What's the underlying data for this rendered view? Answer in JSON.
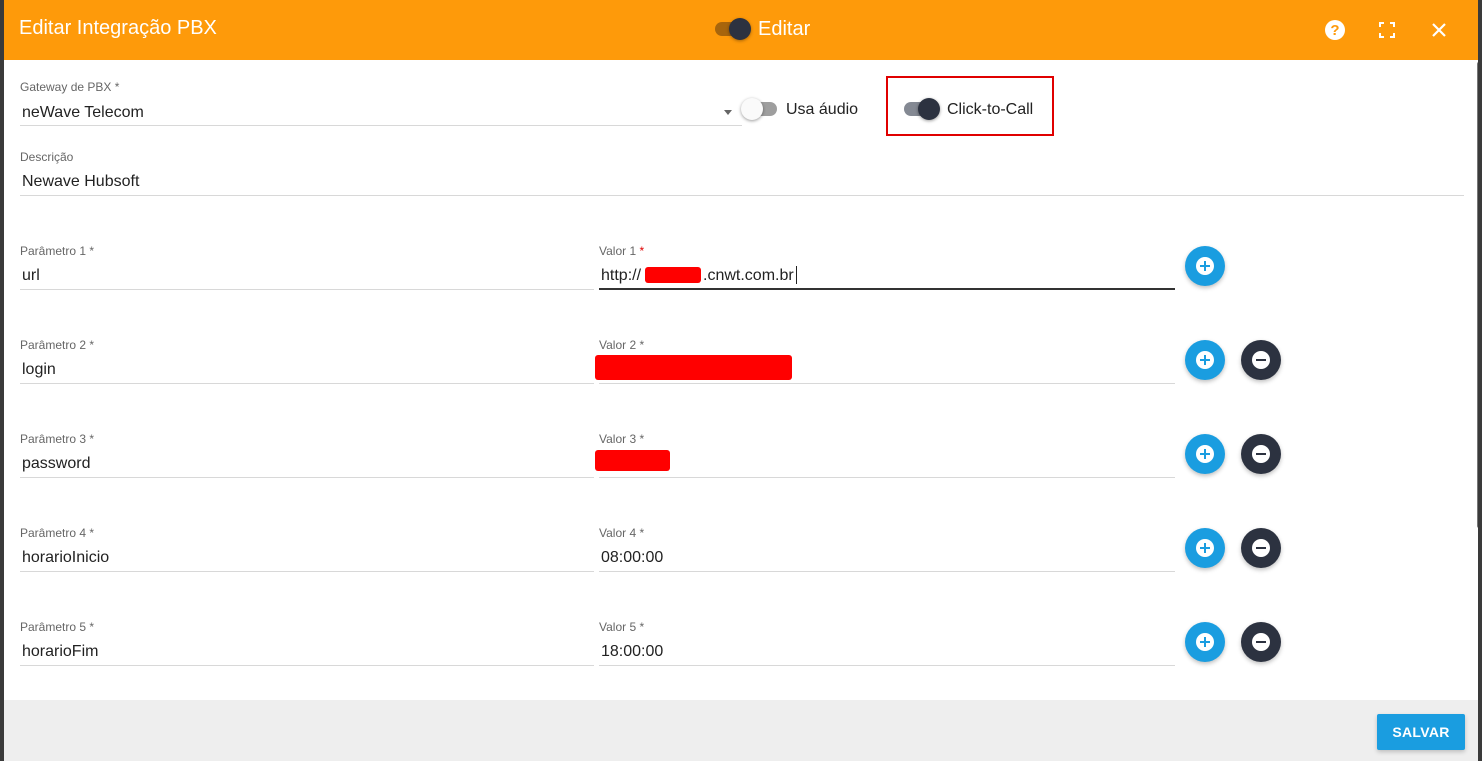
{
  "header": {
    "title": "Editar Integração PBX",
    "mode_label": "Editar",
    "mode_toggle_on": true,
    "help_symbol": "?",
    "icons": [
      "help-icon",
      "fullscreen-icon",
      "close-icon"
    ]
  },
  "form": {
    "gateway": {
      "label": "Gateway de PBX *",
      "value": "neWave Telecom"
    },
    "usa_audio": {
      "label": "Usa áudio",
      "on": false
    },
    "click_to_call": {
      "label": "Click-to-Call",
      "on": true
    },
    "descricao": {
      "label": "Descrição",
      "value": "Newave Hubsoft"
    },
    "params": [
      {
        "param_label": "Parâmetro 1 *",
        "param_value": "url",
        "value_label": "Valor 1",
        "value_required": " *",
        "value_prefix": "http://",
        "value_suffix": ".cnwt.com.br",
        "value": ""
      },
      {
        "param_label": "Parâmetro 2 *",
        "param_value": "login",
        "value_label": "Valor 2 *",
        "value": ""
      },
      {
        "param_label": "Parâmetro 3 *",
        "param_value": "password",
        "value_label": "Valor 3 *",
        "value": ""
      },
      {
        "param_label": "Parâmetro 4 *",
        "param_value": "horarioInicio",
        "value_label": "Valor 4 *",
        "value": "08:00:00"
      },
      {
        "param_label": "Parâmetro 5 *",
        "param_value": "horarioFim",
        "value_label": "Valor 5 *",
        "value": "18:00:00"
      }
    ]
  },
  "footer": {
    "save_label": "SALVAR"
  },
  "colors": {
    "header_bg": "#fe9a0a",
    "accent_blue": "#1a9de0",
    "dark": "#2c3240",
    "highlight_border": "#e00000",
    "redaction": "#ff0000"
  }
}
